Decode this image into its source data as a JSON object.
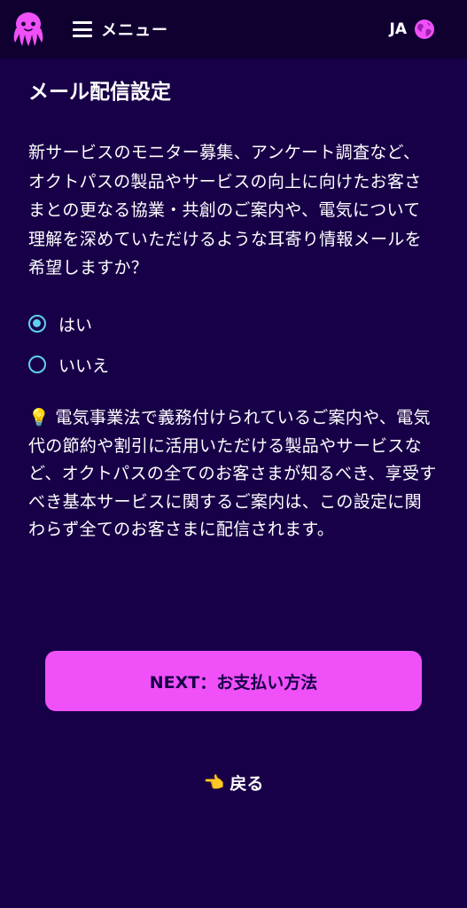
{
  "header": {
    "menu_label": "メニュー",
    "lang_label": "JA",
    "logo_icon": "octopus-logo",
    "accent_color": "#f050f8"
  },
  "main": {
    "title": "メール配信設定",
    "question": "新サービスのモニター募集、アンケート調査など、オクトパスの製品やサービスの向上に向けたお客さまとの更なる協業・共創のご案内や、電気について理解を深めていただけるような耳寄り情報メールを希望しますか？",
    "options": [
      {
        "label": "はい",
        "selected": true
      },
      {
        "label": "いいえ",
        "selected": false
      }
    ],
    "notice_icon": "💡",
    "notice": "電気事業法で義務付けられているご案内や、電気代の節約や割引に活用いただける製品やサービスなど、オクトパスの全てのお客さまが知るべき、享受すべき基本サービスに関するご案内は、この設定に関わらず全てのお客さまに配信されます。"
  },
  "actions": {
    "next_label": "NEXT：お支払い方法",
    "back_icon": "👈",
    "back_label": "戻る"
  }
}
